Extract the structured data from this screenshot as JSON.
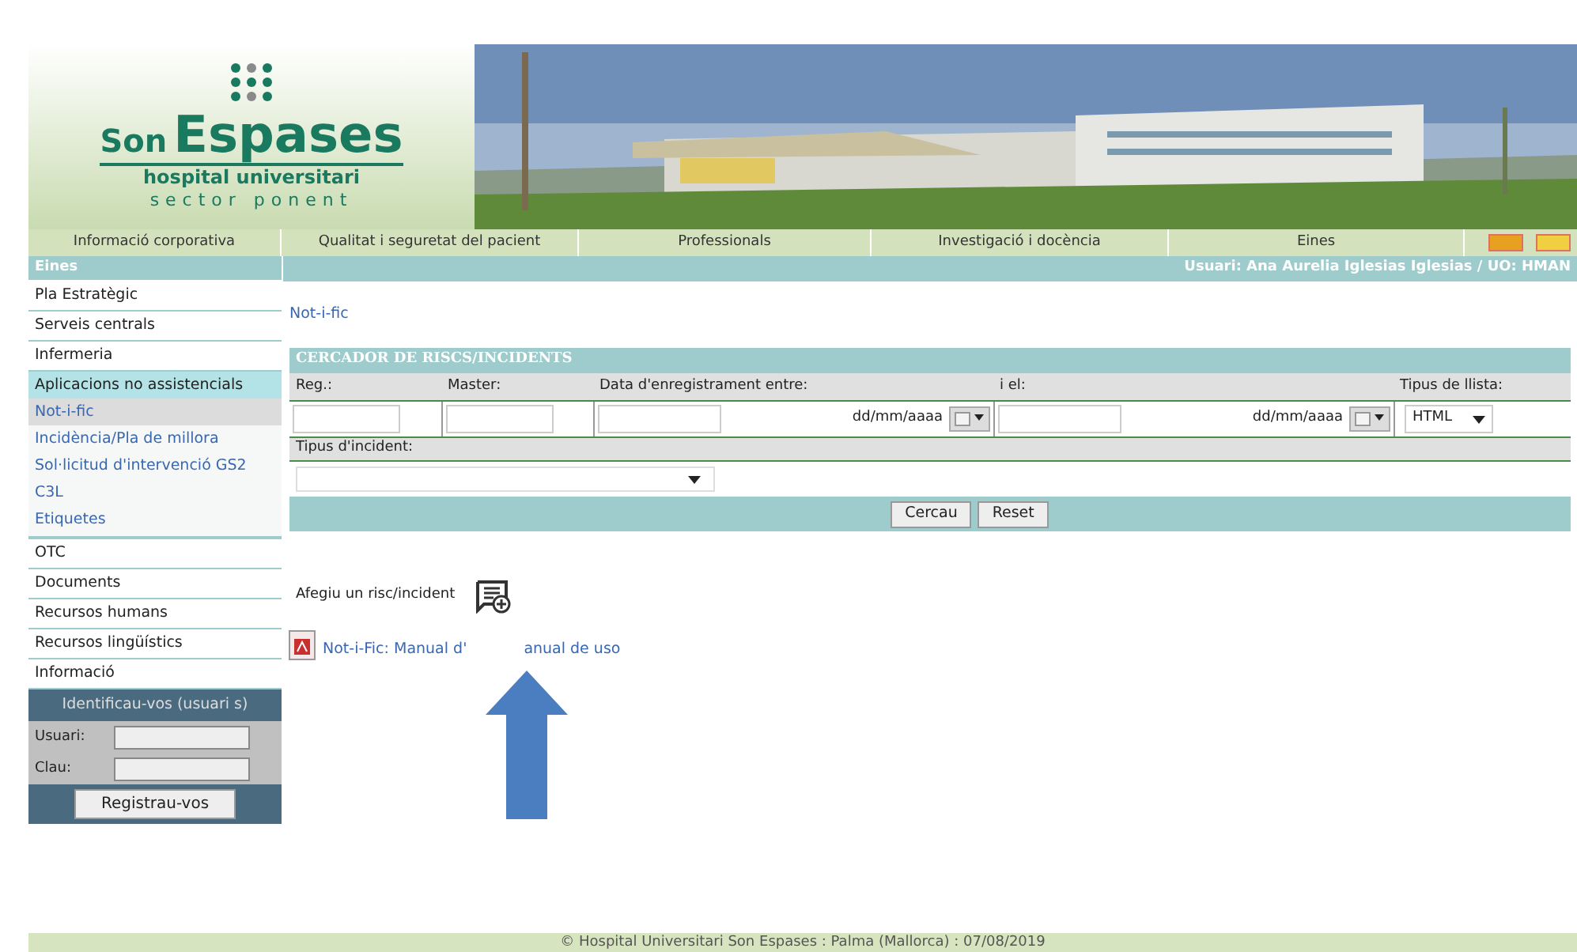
{
  "logo": {
    "name_small": "Son",
    "name_large": "Espases",
    "subtitle": "hospital universitari",
    "tagline": "sector ponent"
  },
  "nav": [
    {
      "label": "Informació corporativa"
    },
    {
      "label": "Qualitat i seguretat del pacient"
    },
    {
      "label": "Professionals"
    },
    {
      "label": "Investigació i docència"
    },
    {
      "label": "Eines"
    }
  ],
  "languages": [
    {
      "color": "#e8a020"
    },
    {
      "color": "#f0d040"
    }
  ],
  "user_bar": "Usuari: Ana Aurelia Iglesias Iglesias / UO: HMAN",
  "sidebar": {
    "header": "Eines",
    "items": [
      {
        "kind": "item",
        "label": "Pla Estratègic"
      },
      {
        "kind": "item",
        "label": "Serveis centrals"
      },
      {
        "kind": "item",
        "label": "Infermeria"
      },
      {
        "kind": "group",
        "label": "Aplicacions no assistencials",
        "children": [
          {
            "label": "Not-i-fic",
            "selected": true
          },
          {
            "label": "Incidència/Pla de millora",
            "selected": false
          },
          {
            "label": "Sol·licitud d'intervenció GS2",
            "selected": false
          },
          {
            "label": "C3L",
            "selected": false
          },
          {
            "label": "Etiquetes",
            "selected": false
          }
        ]
      },
      {
        "kind": "item",
        "label": "OTC"
      },
      {
        "kind": "item",
        "label": "Documents"
      },
      {
        "kind": "item",
        "label": "Recursos humans"
      },
      {
        "kind": "item",
        "label": "Recursos lingüístics"
      },
      {
        "kind": "item",
        "label": "Informació"
      }
    ]
  },
  "login": {
    "title": "Identificau-vos (usuari s)",
    "user_label": "Usuari:",
    "password_label": "Clau:",
    "button": "Registrau-vos"
  },
  "breadcrumb": "Not-i-fic",
  "search": {
    "title": "CERCADOR DE RISCS/INCIDENTS",
    "fields": [
      {
        "kind": "text",
        "label": "Reg.:"
      },
      {
        "kind": "text",
        "label": "Master:"
      },
      {
        "kind": "date",
        "label": "Data d'enregistrament entre:",
        "hint": "dd/mm/aaaa"
      },
      {
        "kind": "date",
        "label": "i el:",
        "hint": "dd/mm/aaaa"
      },
      {
        "kind": "select",
        "label": "Tipus de llista:",
        "value": "HTML"
      }
    ],
    "incident_type_label": "Tipus d'incident:",
    "buttons": [
      "Cercau",
      "Reset"
    ]
  },
  "add_link": "Afegiu un risc/incident",
  "manual_link": {
    "before": "Not-i-Fic: Manual d'",
    "after": "anual de uso"
  },
  "footer": "© Hospital Universitari Son Espases : Palma (Mallorca) : 07/08/2019"
}
